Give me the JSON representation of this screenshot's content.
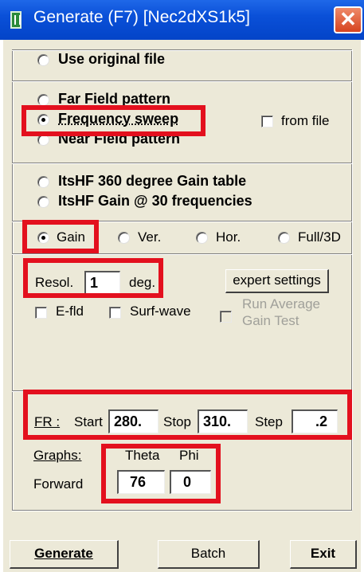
{
  "window": {
    "title": "Generate (F7)      [Nec2dXS1k5]",
    "close_glyph": "✕",
    "app_icon": "nec-app-icon"
  },
  "source": {
    "use_original": "Use original file",
    "far_field": "Far Field pattern",
    "frequency_sweep": "Frequency sweep",
    "near_field": "Near Field pattern",
    "from_file": "from file",
    "selected": "Frequency sweep"
  },
  "itshf": {
    "gain_table": "ItsHF 360 degree Gain table",
    "gain_freqs": "ItsHF Gain @ 30 frequencies"
  },
  "pattern_type": {
    "gain": "Gain",
    "ver": "Ver.",
    "hor": "Hor.",
    "full3d": "Full/3D",
    "selected": "Gain"
  },
  "resolution": {
    "label": "Resol.",
    "value": "1",
    "unit": "deg.",
    "expert": "expert settings"
  },
  "options": {
    "efld": "E-fld",
    "surf_wave": "Surf-wave",
    "run_avg_1": "Run Average",
    "run_avg_2": "Gain Test"
  },
  "fr": {
    "label": "FR :",
    "start_label": "Start",
    "start": "280.",
    "stop_label": "Stop",
    "stop": "310.",
    "step_label": "Step",
    "step": ".2"
  },
  "graphs": {
    "label": "Graphs:",
    "theta_label": "Theta",
    "phi_label": "Phi",
    "forward_label": "Forward",
    "theta": "76",
    "phi": "0"
  },
  "footer": {
    "generate": "Generate",
    "batch": "Batch",
    "exit": "Exit"
  },
  "colors": {
    "titlebar": "#0a50d8",
    "dialog_bg": "#ece9d8",
    "highlight": "#e3101e"
  }
}
